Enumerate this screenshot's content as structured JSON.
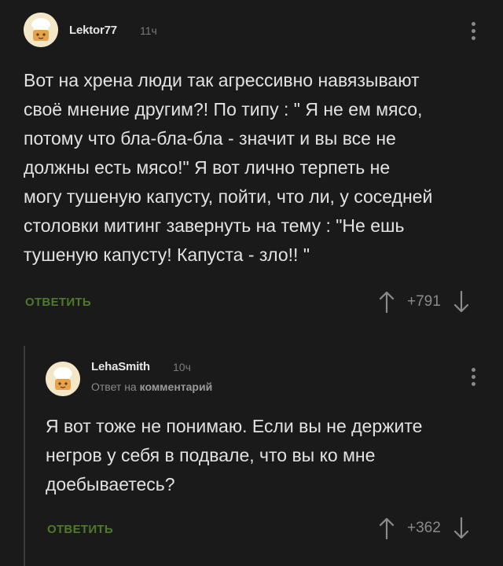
{
  "comments": [
    {
      "username": "Lektor77",
      "time": "11ч",
      "lines": [
        "Вот на хрена люди так агрессивно навязывают",
        "своё мнение другим?! По типу : \" Я не ем мясо,",
        "потому что бла-бла-бла - значит и вы все не",
        "должны есть мясо!\" Я вот лично терпеть не",
        "могу тушеную капусту, пойти, что ли, у соседней",
        "столовки митинг завернуть на тему : \"Не ешь",
        "тушеную капусту! Капуста - зло!! \""
      ],
      "reply_label": "ОТВЕТИТЬ",
      "score": "+791",
      "icons": {
        "upvote": "arrow-up-icon",
        "downvote": "arrow-down-icon",
        "menu": "kebab-menu-icon"
      }
    },
    {
      "username": "LehaSmith",
      "time": "10ч",
      "reply_to_prefix": "Ответ на",
      "reply_to_target": "комментарий",
      "lines": [
        "Я вот тоже не понимаю. Если вы не держите",
        "негров у себя в подвале, что вы ко мне",
        "доебываетесь?"
      ],
      "reply_label": "ОТВЕТИТЬ",
      "score": "+362",
      "icons": {
        "upvote": "arrow-up-icon",
        "downvote": "arrow-down-icon",
        "menu": "kebab-menu-icon"
      }
    }
  ],
  "colors": {
    "background": "#1a1a1a",
    "reply_green": "#4e7a2a",
    "muted": "#8a8a8a"
  }
}
